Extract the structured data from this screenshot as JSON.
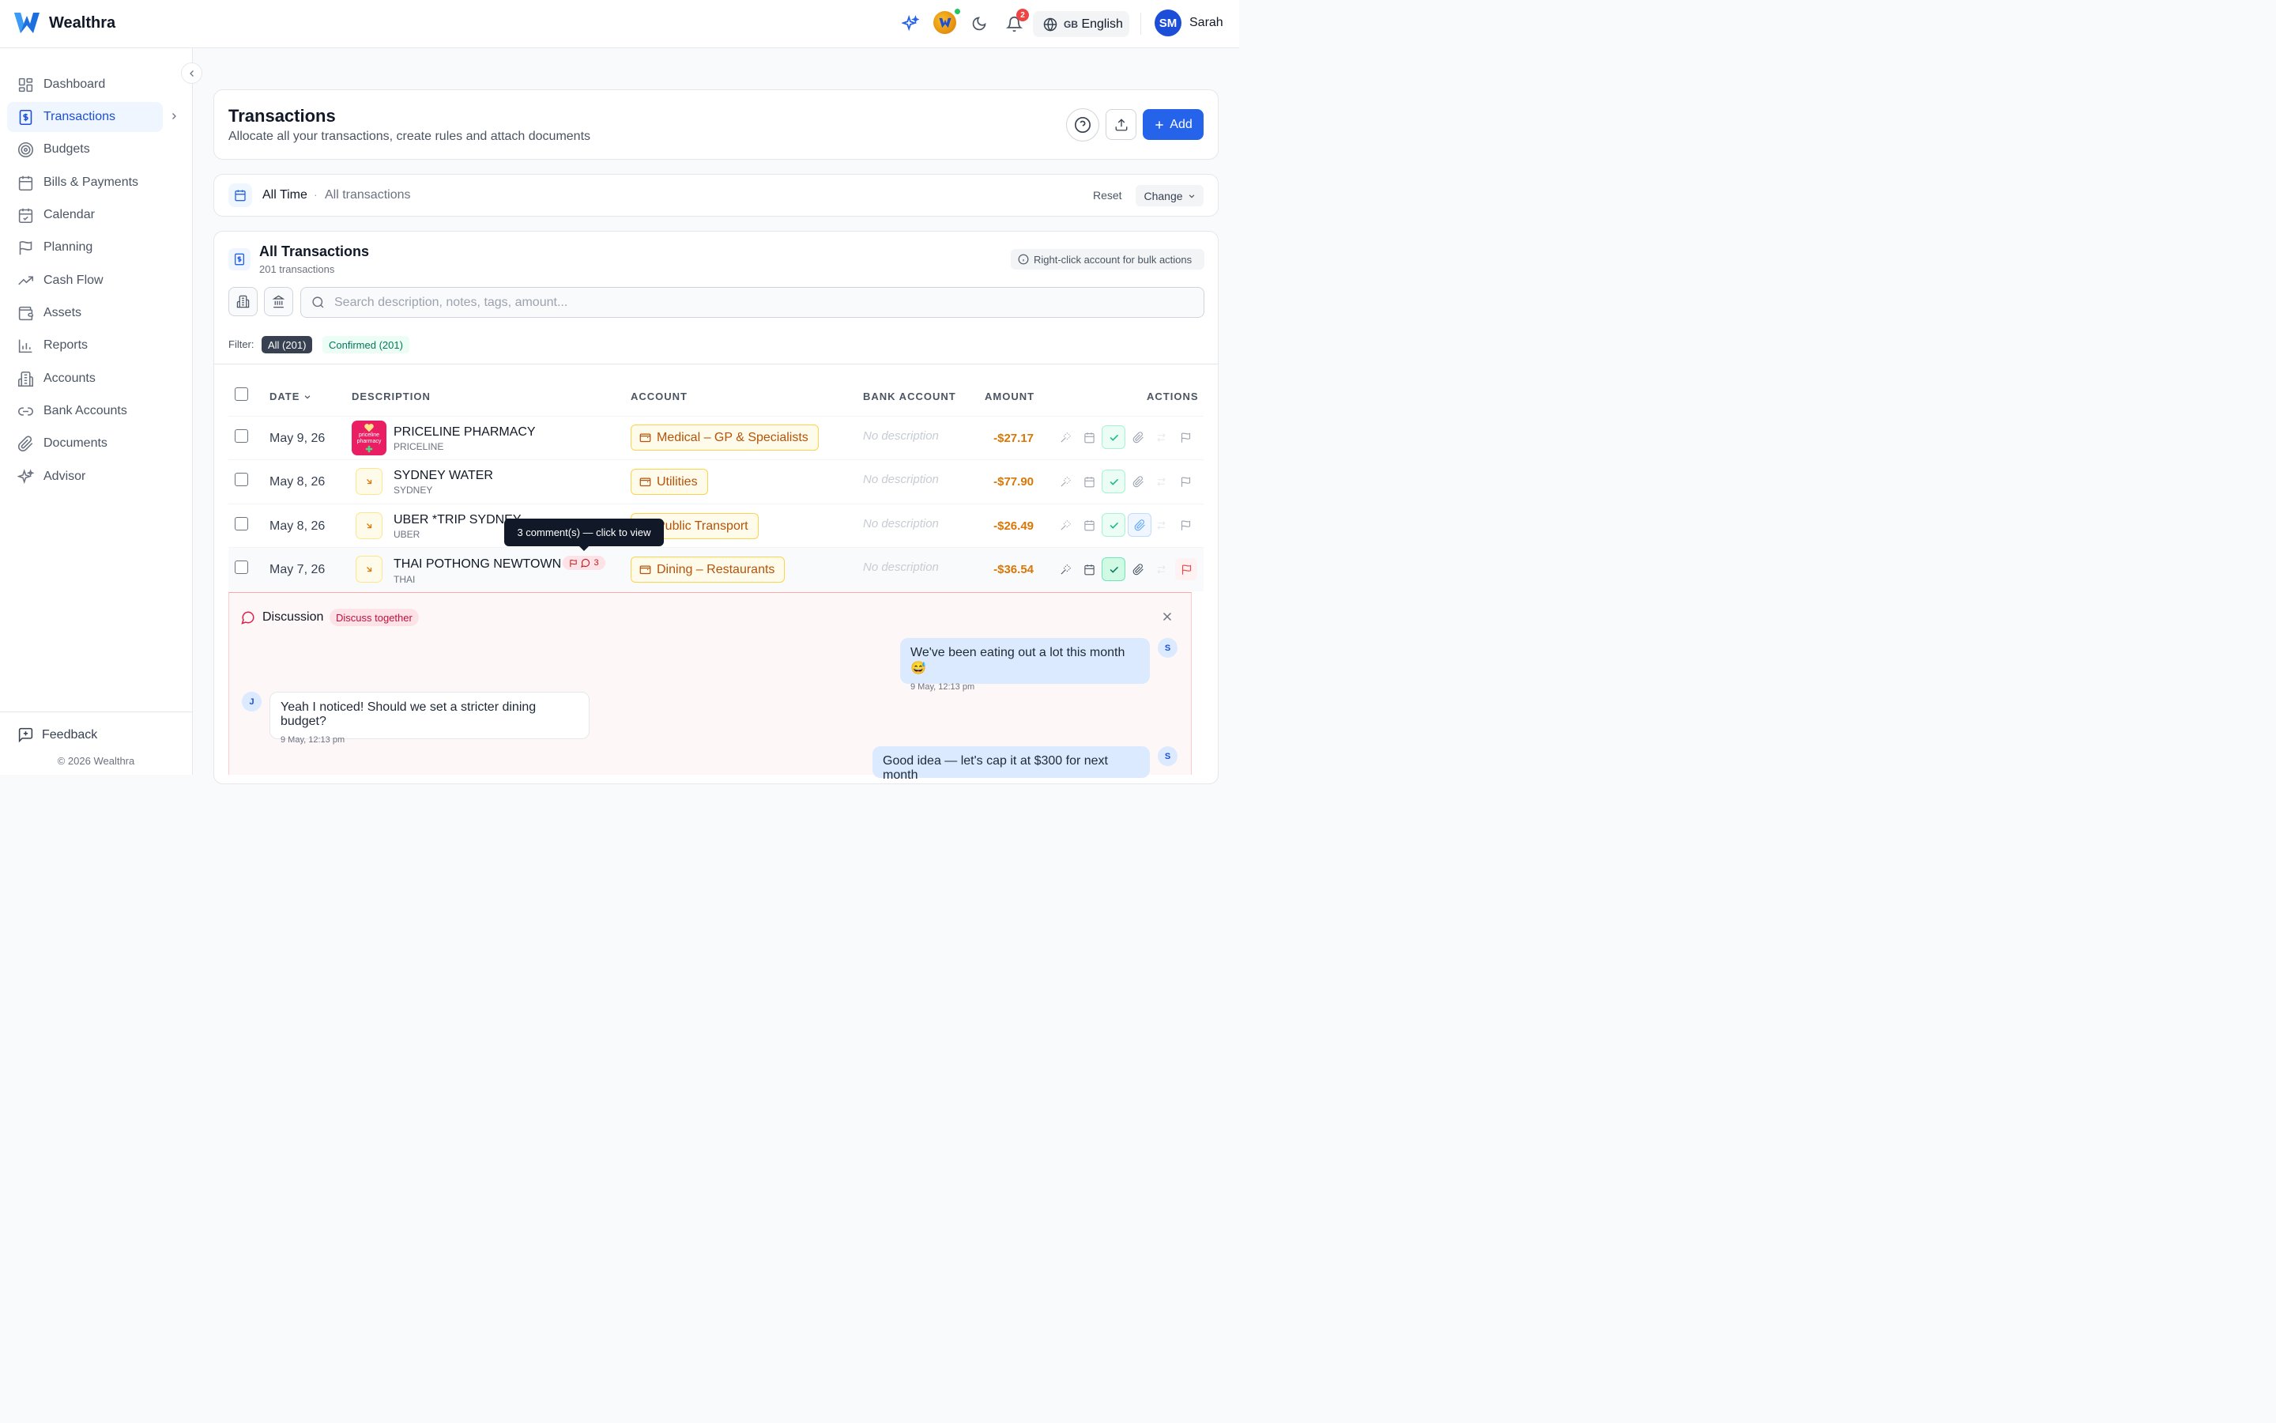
{
  "app": {
    "name": "Wealthra"
  },
  "topbar": {
    "notifications_count": "2",
    "language_flag": "GB",
    "language": "English",
    "user_initials": "SM",
    "user_name": "Sarah"
  },
  "sidebar": {
    "items": [
      {
        "label": "Dashboard",
        "icon": "dashboard-icon"
      },
      {
        "label": "Transactions",
        "icon": "dollar-receipt-icon",
        "active": true
      },
      {
        "label": "Budgets",
        "icon": "target-icon"
      },
      {
        "label": "Bills & Payments",
        "icon": "calendar-grid-icon"
      },
      {
        "label": "Calendar",
        "icon": "calendar-check-icon"
      },
      {
        "label": "Planning",
        "icon": "flag-icon"
      },
      {
        "label": "Cash Flow",
        "icon": "trend-up-icon"
      },
      {
        "label": "Assets",
        "icon": "wallet-icon"
      },
      {
        "label": "Reports",
        "icon": "bar-chart-icon"
      },
      {
        "label": "Accounts",
        "icon": "building-icon"
      },
      {
        "label": "Bank Accounts",
        "icon": "link-icon"
      },
      {
        "label": "Documents",
        "icon": "paperclip-icon"
      },
      {
        "label": "Advisor",
        "icon": "sparkles-icon"
      }
    ],
    "feedback": "Feedback",
    "copyright": "© 2026 Wealthra"
  },
  "header": {
    "title": "Transactions",
    "subtitle": "Allocate all your transactions, create rules and attach documents",
    "add_label": "Add"
  },
  "period": {
    "label": "All Time",
    "sub": "All transactions",
    "reset": "Reset",
    "change": "Change"
  },
  "list": {
    "title": "All Transactions",
    "count": "201 transactions",
    "hint": "Right-click account for bulk actions",
    "search_placeholder": "Search description, notes, tags, amount...",
    "filter_label": "Filter:",
    "filter_all": "All (201)",
    "filter_confirmed": "Confirmed (201)"
  },
  "columns": {
    "date": "DATE",
    "description": "DESCRIPTION",
    "account": "ACCOUNT",
    "bank_account": "BANK ACCOUNT",
    "amount": "AMOUNT",
    "actions": "ACTIONS"
  },
  "rows": [
    {
      "date": "May 9, 26",
      "desc": "PRICELINE PHARMACY",
      "sub": "PRICELINE",
      "account": "Medical – GP & Specialists",
      "bank": "No description",
      "amount": "-$27.17"
    },
    {
      "date": "May 8, 26",
      "desc": "SYDNEY WATER",
      "sub": "SYDNEY",
      "account": "Utilities",
      "bank": "No description",
      "amount": "-$77.90"
    },
    {
      "date": "May 8, 26",
      "desc": "UBER *TRIP SYDNEY",
      "sub": "UBER",
      "account": "Public Transport",
      "bank": "No description",
      "amount": "-$26.49"
    },
    {
      "date": "May 7, 26",
      "desc": "THAI POTHONG NEWTOWN",
      "sub": "THAI",
      "account": "Dining – Restaurants",
      "bank": "No description",
      "amount": "-$36.54",
      "comments": "3"
    }
  ],
  "tooltip": "3 comment(s) — click to view",
  "logo_text": {
    "line1": "priceline",
    "line2": "pharmacy"
  },
  "discussion": {
    "title": "Discussion",
    "tag": "Discuss together",
    "messages": [
      {
        "from": "S",
        "text": "We've been eating out a lot this month 😅",
        "time": "9 May, 12:13 pm"
      },
      {
        "from": "J",
        "text": "Yeah I noticed! Should we set a stricter dining budget?",
        "time": "9 May, 12:13 pm"
      },
      {
        "from": "S",
        "text": "Good idea — let's cap it at $300 for next month",
        "time": ""
      }
    ]
  },
  "colors": {
    "accent": "#2563eb",
    "amount": "#d97706",
    "account_pill": "#b45309"
  }
}
